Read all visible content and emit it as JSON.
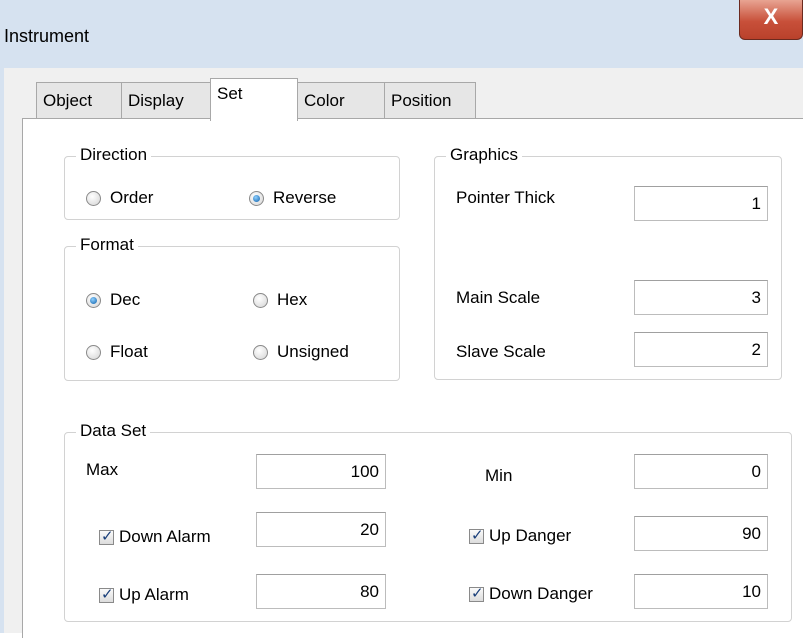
{
  "window": {
    "title": "Instrument",
    "close_glyph": "X"
  },
  "tabs": [
    {
      "label": "Object",
      "active": false
    },
    {
      "label": "Display",
      "active": false
    },
    {
      "label": "Set",
      "active": true
    },
    {
      "label": "Color",
      "active": false
    },
    {
      "label": "Position",
      "active": false
    }
  ],
  "direction": {
    "title": "Direction",
    "options": [
      {
        "label": "Order",
        "selected": false
      },
      {
        "label": "Reverse",
        "selected": true
      }
    ]
  },
  "format": {
    "title": "Format",
    "options": [
      {
        "label": "Dec",
        "selected": true
      },
      {
        "label": "Hex",
        "selected": false
      },
      {
        "label": "Float",
        "selected": false
      },
      {
        "label": "Unsigned",
        "selected": false
      }
    ]
  },
  "graphics": {
    "title": "Graphics",
    "pointer_thick": {
      "label": "Pointer Thick",
      "value": "1"
    },
    "main_scale": {
      "label": "Main Scale",
      "value": "3"
    },
    "slave_scale": {
      "label": "Slave Scale",
      "value": "2"
    }
  },
  "data_set": {
    "title": "Data Set",
    "max": {
      "label": "Max",
      "value": "100"
    },
    "min": {
      "label": "Min",
      "value": "0"
    },
    "down_alarm": {
      "label": "Down Alarm",
      "checked": true,
      "value": "20"
    },
    "up_danger": {
      "label": "Up Danger",
      "checked": true,
      "value": "90"
    },
    "up_alarm": {
      "label": "Up Alarm",
      "checked": true,
      "value": "80"
    },
    "down_danger": {
      "label": "Down Danger",
      "checked": true,
      "value": "10"
    }
  }
}
